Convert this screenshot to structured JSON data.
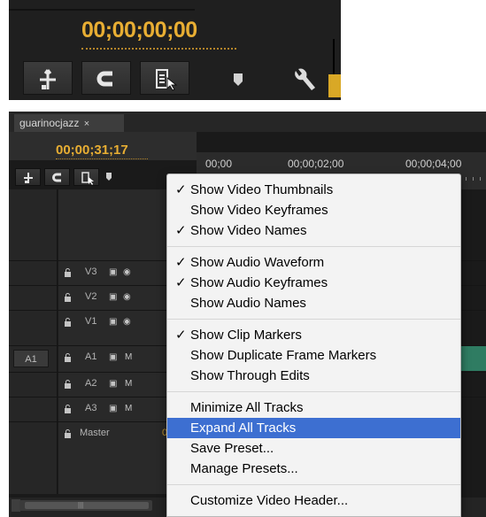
{
  "zoomed_header": {
    "timecode": "00;00;00;00",
    "buttons": [
      "snap-button",
      "linked-selection-button",
      "add-marker-button",
      "settings-dropdown",
      "wrench-icon"
    ]
  },
  "sequence_panel": {
    "tab_title": "guarinocjazz",
    "tab_close": "×",
    "timecode": "00;00;31;17",
    "ruler_labels": [
      "00;00",
      "00;00;02;00",
      "00;00;04;00"
    ],
    "tracks": [
      {
        "name": "V3",
        "source": "",
        "icons": [
          "film",
          "eye"
        ]
      },
      {
        "name": "V2",
        "source": "",
        "icons": [
          "film",
          "eye"
        ]
      },
      {
        "name": "V1",
        "source": "",
        "icons": [
          "film",
          "eye"
        ]
      },
      {
        "name": "A1",
        "source": "A1",
        "icons": [
          "film",
          "M"
        ]
      },
      {
        "name": "A2",
        "source": "",
        "icons": [
          "film",
          "M"
        ]
      },
      {
        "name": "A3",
        "source": "",
        "icons": [
          "film",
          "M"
        ]
      }
    ],
    "master": {
      "name": "Master",
      "value": "0.0"
    },
    "scrollbar_grip": "|||",
    "colors": {
      "timecode": "#e8ae33",
      "audio_clip": "#2f7c62",
      "menu_highlight": "#3d6fd1"
    }
  },
  "context_menu": {
    "groups": [
      [
        {
          "label": "Show Video Thumbnails",
          "checked": "✓"
        },
        {
          "label": "Show Video Keyframes",
          "checked": ""
        },
        {
          "label": "Show Video Names",
          "checked": "✓"
        }
      ],
      [
        {
          "label": "Show Audio Waveform",
          "checked": "✓"
        },
        {
          "label": "Show Audio Keyframes",
          "checked": "✓"
        },
        {
          "label": "Show Audio Names",
          "checked": ""
        }
      ],
      [
        {
          "label": "Show Clip Markers",
          "checked": "✓"
        },
        {
          "label": "Show Duplicate Frame Markers",
          "checked": ""
        },
        {
          "label": "Show Through Edits",
          "checked": ""
        }
      ],
      [
        {
          "label": "Minimize All Tracks",
          "checked": ""
        },
        {
          "label": "Expand All Tracks",
          "checked": "",
          "highlighted": true
        },
        {
          "label": "Save Preset...",
          "checked": ""
        },
        {
          "label": "Manage Presets...",
          "checked": ""
        }
      ],
      [
        {
          "label": "Customize Video Header...",
          "checked": ""
        }
      ]
    ]
  }
}
